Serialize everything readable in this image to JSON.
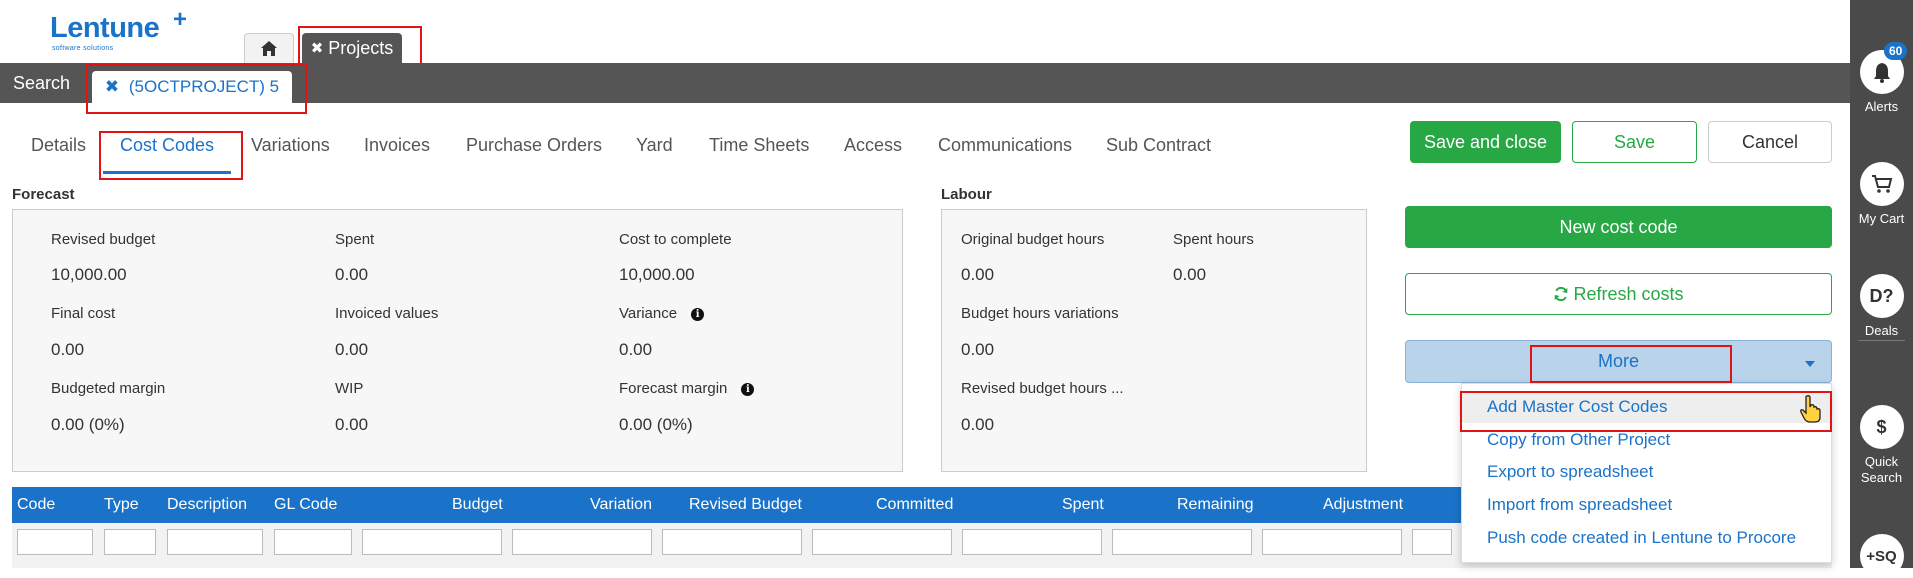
{
  "header": {
    "logo_text": "Lentune",
    "logo_plus": "+",
    "logo_sub": "software solutions",
    "projects_tab": "Projects",
    "search_label": "Search",
    "project_tab": "(5OCTPROJECT) 5",
    "close_glyph": "✖"
  },
  "subtabs": [
    "Details",
    "Cost Codes",
    "Variations",
    "Invoices",
    "Purchase Orders",
    "Yard",
    "Time Sheets",
    "Access",
    "Communications",
    "Sub Contract"
  ],
  "active_subtab": "Cost Codes",
  "actions": {
    "save_close": "Save and close",
    "save": "Save",
    "cancel": "Cancel",
    "new_cost_code": "New cost code",
    "refresh_costs": "Refresh costs",
    "more": "More"
  },
  "forecast": {
    "title": "Forecast",
    "fields": [
      {
        "label": "Revised budget",
        "value": "10,000.00"
      },
      {
        "label": "Spent",
        "value": "0.00"
      },
      {
        "label": "Cost to complete",
        "value": "10,000.00"
      },
      {
        "label": "Final cost",
        "value": "0.00"
      },
      {
        "label": "Invoiced values",
        "value": "0.00"
      },
      {
        "label": "Variance",
        "value": "0.00"
      },
      {
        "label": "Budgeted margin",
        "value": "0.00 (0%)"
      },
      {
        "label": "WIP",
        "value": "0.00"
      },
      {
        "label": "Forecast margin",
        "value": "0.00 (0%)"
      }
    ]
  },
  "labour": {
    "title": "Labour",
    "fields": [
      {
        "label": "Original budget hours",
        "value": "0.00"
      },
      {
        "label": "Spent hours",
        "value": "0.00"
      },
      {
        "label": "Budget hours variations",
        "value": "0.00"
      },
      {
        "label": "Revised budget hours ...",
        "value": "0.00"
      }
    ]
  },
  "table": {
    "columns": [
      "Code",
      "Type",
      "Description",
      "GL Code",
      "Budget",
      "Variation",
      "Revised Budget",
      "Committed",
      "Spent",
      "Remaining",
      "Adjustment"
    ]
  },
  "more_menu": [
    "Add Master Cost Codes",
    "Copy from Other Project",
    "Export to spreadsheet",
    "Import from spreadsheet",
    "Push code created in Lentune to Procore"
  ],
  "rail": {
    "alerts_count": "60",
    "alerts": "Alerts",
    "cart": "My Cart",
    "deals_glyph": "D?",
    "deals": "Deals",
    "quick_glyph": "$",
    "quick_search": "Quick Search",
    "sq_glyph": "+SQ"
  },
  "colors": {
    "brand_blue": "#1a73c8",
    "green": "#27a845",
    "dark_bar": "#555555",
    "rail": "#4a4a4a",
    "highlight": "#e01414"
  }
}
